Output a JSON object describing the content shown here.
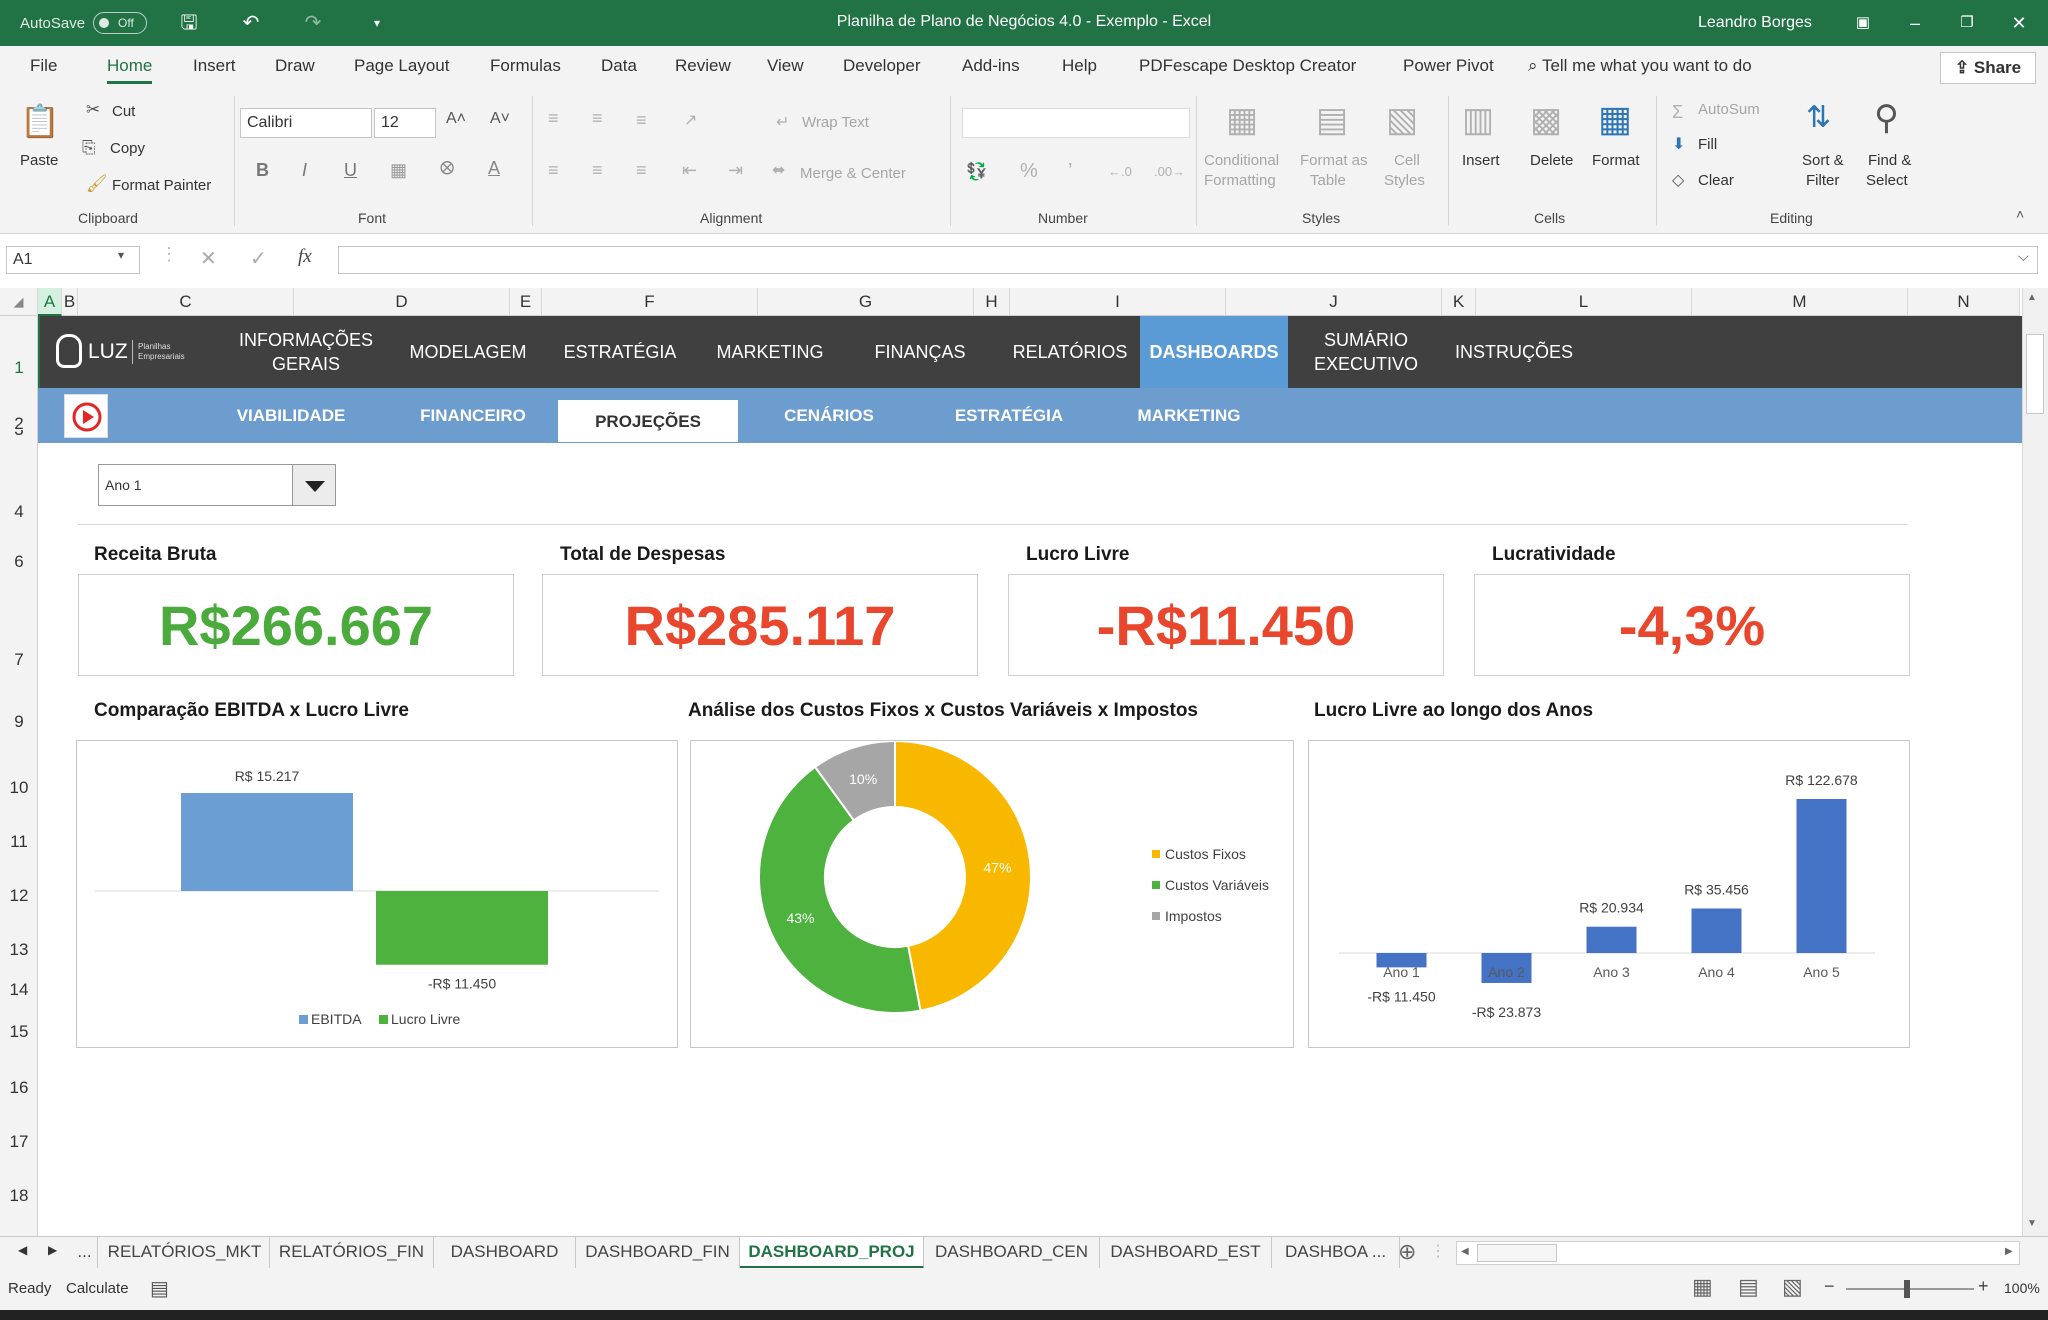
{
  "titlebar": {
    "autosave_label": "AutoSave",
    "autosave_state": "Off",
    "doc_title": "Planilha de Plano de Negócios 4.0 - Exemplo  -  Excel",
    "user": "Leandro Borges"
  },
  "menu": {
    "items": [
      "File",
      "Home",
      "Insert",
      "Draw",
      "Page Layout",
      "Formulas",
      "Data",
      "Review",
      "View",
      "Developer",
      "Add-ins",
      "Help",
      "PDFescape Desktop Creator",
      "Power Pivot"
    ],
    "active": "Home",
    "tell_me": "Tell me what you want to do",
    "share": "Share"
  },
  "ribbon": {
    "clipboard": {
      "paste": "Paste",
      "cut": "Cut",
      "copy": "Copy",
      "format_painter": "Format Painter",
      "label": "Clipboard"
    },
    "font": {
      "name": "Calibri",
      "size": "12",
      "label": "Font"
    },
    "alignment": {
      "wrap": "Wrap Text",
      "merge": "Merge & Center",
      "label": "Alignment"
    },
    "number": {
      "label": "Number"
    },
    "styles": {
      "cond1": "Conditional",
      "cond2": "Formatting",
      "fmt1": "Format as",
      "fmt2": "Table",
      "cell1": "Cell",
      "cell2": "Styles",
      "label": "Styles"
    },
    "cells": {
      "insert": "Insert",
      "delete": "Delete",
      "format": "Format",
      "label": "Cells"
    },
    "editing": {
      "autosum": "AutoSum",
      "fill": "Fill",
      "clear": "Clear",
      "sort1": "Sort &",
      "sort2": "Filter",
      "find1": "Find &",
      "find2": "Select",
      "label": "Editing"
    }
  },
  "formula_bar": {
    "name_box": "A1",
    "fx": "fx",
    "value": ""
  },
  "columns": [
    "A",
    "B",
    "C",
    "D",
    "E",
    "F",
    "G",
    "H",
    "I",
    "J",
    "K",
    "L",
    "M",
    "N"
  ],
  "rows": [
    "1",
    "2",
    "3",
    "4",
    "6",
    "7",
    "9",
    "10",
    "11",
    "12",
    "13",
    "14",
    "15",
    "16",
    "17",
    "18"
  ],
  "nav": {
    "brand": "LUZ",
    "brand_sub1": "Planilhas",
    "brand_sub2": "Empresariais",
    "items": [
      "INFORMAÇÕES\nGERAIS",
      "MODELAGEM",
      "ESTRATÉGIA",
      "MARKETING",
      "FINANÇAS",
      "RELATÓRIOS",
      "DASHBOARDS",
      "SUMÁRIO\nEXECUTIVO",
      "INSTRUÇÕES"
    ],
    "active": "DASHBOARDS",
    "sub_items": [
      "VIABILIDADE",
      "FINANCEIRO",
      "PROJEÇÕES",
      "CENÁRIOS",
      "ESTRATÉGIA",
      "MARKETING"
    ],
    "sub_active": "PROJEÇÕES"
  },
  "filter": {
    "year": "Ano 1"
  },
  "kpis": [
    {
      "title": "Receita Bruta",
      "value": "R$266.667",
      "color": "#4aaa3c"
    },
    {
      "title": "Total de Despesas",
      "value": "R$285.117",
      "color": "#e8472e"
    },
    {
      "title": "Lucro Livre",
      "value": "-R$11.450",
      "color": "#e8472e"
    },
    {
      "title": "Lucratividade",
      "value": "-4,3%",
      "color": "#e8472e"
    }
  ],
  "chart_data": [
    {
      "type": "bar",
      "title": "Comparação EBITDA x Lucro Livre",
      "categories": [
        "EBITDA",
        "Lucro Livre"
      ],
      "values": [
        15217,
        -11450
      ],
      "data_labels": [
        "R$ 15.217",
        "-R$ 11.450"
      ],
      "colors": [
        "#6b9fd4",
        "#4eb23e"
      ],
      "legend": [
        "EBITDA",
        "Lucro Livre"
      ],
      "legend_position": "bottom"
    },
    {
      "type": "pie",
      "title": "Análise dos Custos Fixos x Custos Variáveis x Impostos",
      "categories": [
        "Custos Fixos",
        "Custos Variáveis",
        "Impostos"
      ],
      "values": [
        47,
        43,
        10
      ],
      "data_labels": [
        "47%",
        "43%",
        "10%"
      ],
      "colors": [
        "#f9b800",
        "#4eb23e",
        "#a6a6a6"
      ],
      "legend_position": "right"
    },
    {
      "type": "bar",
      "title": "Lucro Livre ao longo dos Anos",
      "categories": [
        "Ano 1",
        "Ano 2",
        "Ano 3",
        "Ano 4",
        "Ano 5"
      ],
      "values": [
        -11450,
        -23873,
        20934,
        35456,
        122678
      ],
      "data_labels": [
        "-R$ 11.450",
        "-R$ 23.873",
        "R$ 20.934",
        "R$ 35.456",
        "R$ 122.678"
      ],
      "colors": [
        "#4472c4"
      ]
    }
  ],
  "sheet_tabs": [
    "...",
    "RELATÓRIOS_MKT",
    "RELATÓRIOS_FIN",
    "DASHBOARD",
    "DASHBOARD_FIN",
    "DASHBOARD_PROJ",
    "DASHBOARD_CEN",
    "DASHBOARD_EST",
    "DASHBOA ..."
  ],
  "active_tab": "DASHBOARD_PROJ",
  "status": {
    "ready": "Ready",
    "calculate": "Calculate",
    "zoom": "100%"
  }
}
